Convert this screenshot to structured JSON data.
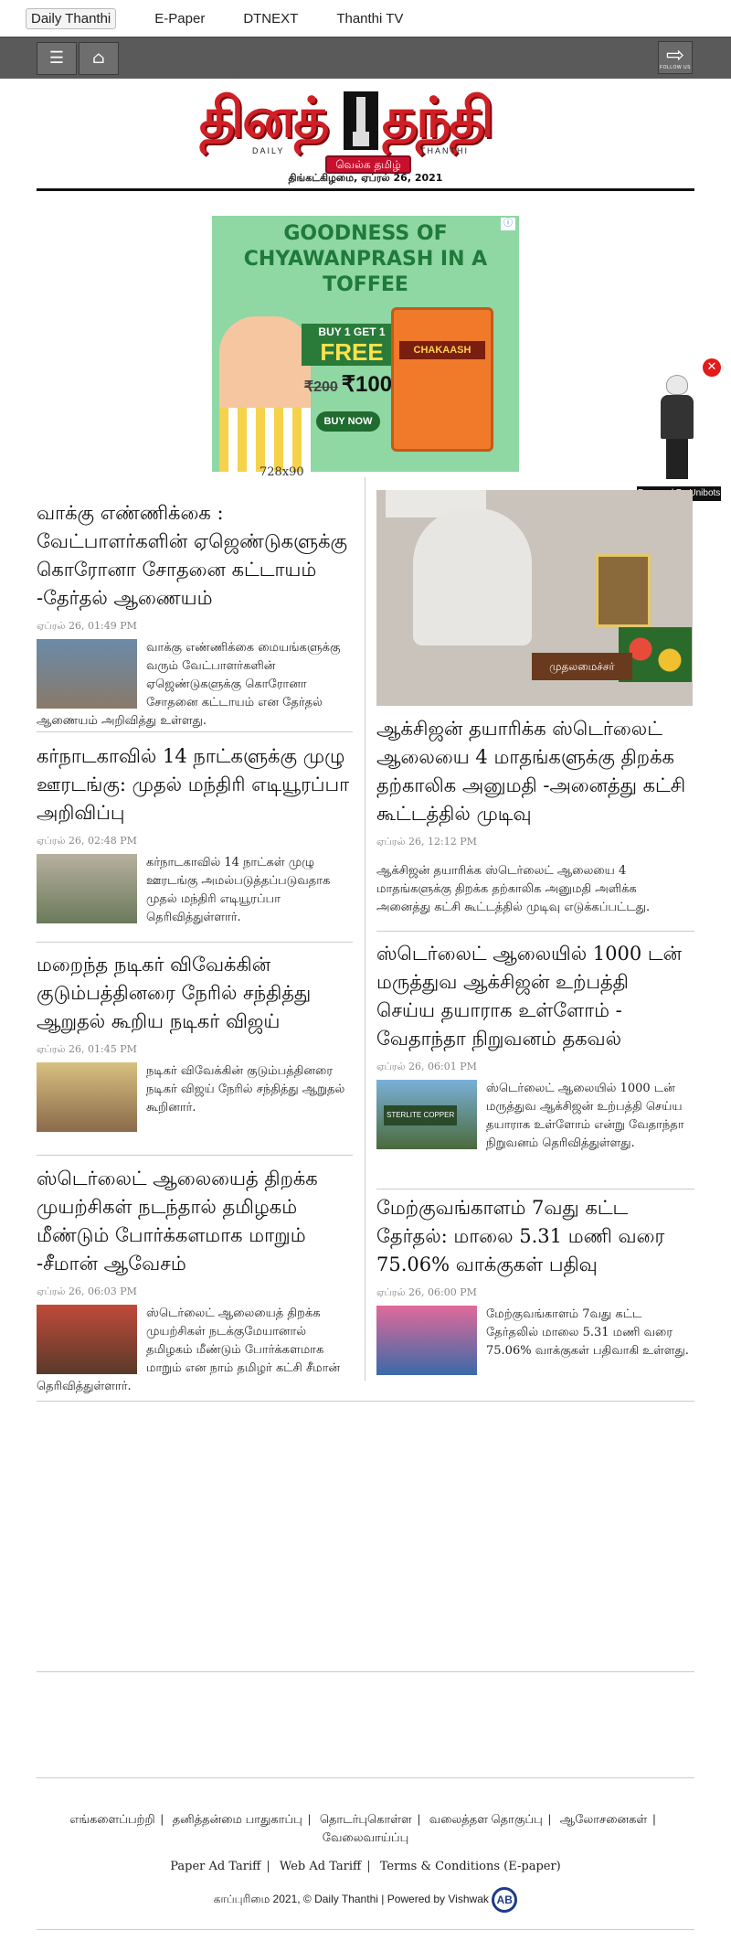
{
  "topnav": {
    "items": [
      "Daily Thanthi",
      "E-Paper",
      "DTNEXT",
      "Thanthi TV"
    ]
  },
  "toolbar": {
    "follow_label": "FOLLOW US"
  },
  "masthead": {
    "logo_left": "தினத்",
    "logo_right": "தந்தி",
    "daily": "DAILY",
    "thanthi": "THANTHI",
    "slogan": "வெல்க தமிழ்",
    "date": "திங்கட்கிழமை, ஏப்ரல் 26, 2021"
  },
  "ad": {
    "headline": "GOODNESS OF CHYAWANPRASH IN A TOFFEE",
    "offer": "BUY 1 GET 1",
    "free": "FREE",
    "old_price": "₹200",
    "new_price": "₹100",
    "cta": "BUY NOW",
    "brand": "CHAKAASH",
    "size_label": "728x90"
  },
  "floater": {
    "powered": "Powered By Unibots"
  },
  "left_articles": [
    {
      "title": "வாக்கு எண்ணிக்கை : வேட்பாளர்களின் ஏஜெண்டுகளுக்கு கொரோனா சோதனை கட்டாயம் -தேர்தல் ஆணையம்",
      "time": "ஏப்ரல் 26, 01:49 PM",
      "snippet": "வாக்கு எண்ணிக்கை மையங்களுக்கு வரும் வேட்பாளர்களின் ஏஜெண்டுகளுக்கு கொரோனா சோதனை கட்டாயம் என தேர்தல் ஆணையம் அறிவித்து உள்ளது."
    },
    {
      "title": "கர்நாடகாவில் 14 நாட்களுக்கு முழு ஊரடங்கு: முதல் மந்திரி எடியூரப்பா அறிவிப்பு",
      "time": "ஏப்ரல் 26, 02:48 PM",
      "snippet": "கர்நாடகாவில் 14 நாட்கள் முழு ஊரடங்கு அமல்படுத்தப்படுவதாக முதல் மந்திரி எடியூரப்பா தெரிவித்துள்ளார்."
    },
    {
      "title": "மறைந்த நடிகர் விவேக்கின் குடும்பத்தினரை நேரில் சந்தித்து ஆறுதல் கூறிய நடிகர் விஜய்",
      "time": "ஏப்ரல் 26, 01:45 PM",
      "snippet": "நடிகர் விவேக்கின் குடும்பத்தினரை நடிகர் விஜய் நேரில் சந்தித்து ஆறுதல் கூறினார்."
    },
    {
      "title": "ஸ்டெர்லைட் ஆலையைத் திறக்க முயற்சிகள் நடந்தால் தமிழகம் மீண்டும் போர்க்களமாக மாறும் -சீமான் ஆவேசம்",
      "time": "ஏப்ரல் 26, 06:03 PM",
      "snippet": "ஸ்டெர்லைட் ஆலையைத் திறக்க முயற்சிகள் நடக்குமேயானால் தமிழகம் மீண்டும் போர்க்களமாக மாறும் என நாம் தமிழர் கட்சி சீமான் தெரிவித்துள்ளார்."
    }
  ],
  "right_articles": [
    {
      "title": "ஆக்சிஜன் தயாரிக்க ஸ்டெர்லைட் ஆலையை 4 மாதங்களுக்கு திறக்க தற்காலிக அனுமதி -அனைத்து கட்சி கூட்டத்தில் முடிவு",
      "time": "ஏப்ரல் 26, 12:12 PM",
      "snippet": "ஆக்சிஜன் தயாரிக்க ஸ்டெர்லைட் ஆலையை 4 மாதங்களுக்கு திறக்க தற்காலிக அனுமதி அளிக்க அனைத்து கட்சி கூட்டத்தில் முடிவு எடுக்கப்பட்டது.",
      "photo_sign": "முதலமைச்சர்"
    },
    {
      "title": "ஸ்டெர்லைட் ஆலையில் 1000 டன் மருத்துவ ஆக்சிஜன் உற்பத்தி செய்ய தயாராக உள்ளோம் - வேதாந்தா நிறுவனம் தகவல்",
      "time": "ஏப்ரல் 26, 06:01 PM",
      "snippet": "ஸ்டெர்லைட் ஆலையில் 1000 டன் மருத்துவ ஆக்சிஜன் உற்பத்தி செய்ய தயாராக உள்ளோம் என்று வேதாந்தா நிறுவனம் தெரிவித்துள்ளது.",
      "thumb_label": "STERLITE COPPER"
    },
    {
      "title": "மேற்குவங்காளம் 7வது கட்ட தேர்தல்: மாலை 5.31 மணி வரை 75.06% வாக்குகள் பதிவு",
      "time": "ஏப்ரல் 26, 06:00 PM",
      "snippet": "மேற்குவங்காளம் 7வது கட்ட தேர்தலில் மாலை 5.31 மணி வரை 75.06% வாக்குகள் பதிவாகி உள்ளது."
    }
  ],
  "footer": {
    "links": [
      "எங்களைப்பற்றி",
      "தனித்தன்மை பாதுகாப்பு",
      "தொடர்புகொள்ள",
      "வலைத்தள தொகுப்பு",
      "ஆலோசனைகள்",
      "வேலைவாய்ப்பு"
    ],
    "links2": [
      "Paper Ad Tariff",
      "Web Ad Tariff",
      "Terms & Conditions (E-paper)"
    ],
    "copyright": "காப்புரிமை 2021, ©  Daily Thanthi | Powered by Vishwak",
    "vishwak_logo": "AB"
  },
  "colors": {
    "brand_red": "#d11f26",
    "toolbar": "#5a5a5a",
    "ad_bg": "#8fd7a3"
  }
}
